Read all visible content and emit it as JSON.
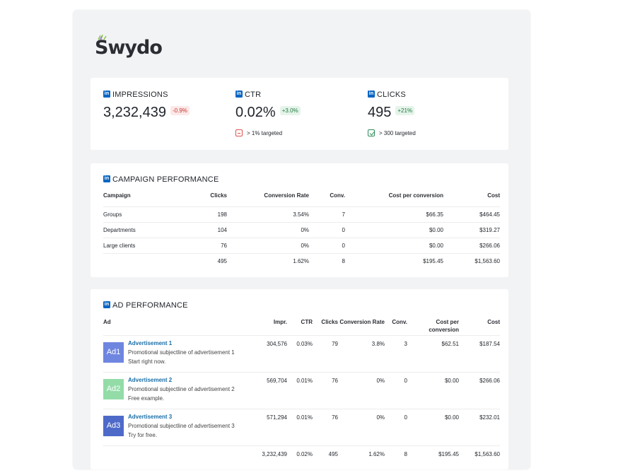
{
  "logo": {
    "text": "Swydo"
  },
  "kpis": [
    {
      "label": "IMPRESSIONS",
      "value": "3,232,439",
      "delta": "-0.9%",
      "delta_type": "negative"
    },
    {
      "label": "CTR",
      "value": "0.02%",
      "delta": "+3.0%",
      "delta_type": "positive",
      "target": "> 1% targeted",
      "target_status": "fail"
    },
    {
      "label": "CLICKS",
      "value": "495",
      "delta": "+21%",
      "delta_type": "positive",
      "target": "> 300 targeted",
      "target_status": "ok"
    }
  ],
  "campaign": {
    "title": "CAMPAIGN PERFORMANCE",
    "headers": [
      "Campaign",
      "Clicks",
      "Conversion Rate",
      "Conv.",
      "Cost per conversion",
      "Cost"
    ],
    "rows": [
      [
        "Groups",
        "198",
        "3.54%",
        "7",
        "$66.35",
        "$464.45"
      ],
      [
        "Departments",
        "104",
        "0%",
        "0",
        "$0.00",
        "$319.27"
      ],
      [
        "Large clients",
        "76",
        "0%",
        "0",
        "$0.00",
        "$266.06"
      ]
    ],
    "total": [
      "",
      "495",
      "1.62%",
      "8",
      "$195.45",
      "$1,563.60"
    ]
  },
  "ads": {
    "title": "AD PERFORMANCE",
    "headers": [
      "Ad",
      "Impr.",
      "CTR",
      "Clicks",
      "Conversion Rate",
      "Conv.",
      "Cost per conversion",
      "Cost"
    ],
    "rows": [
      {
        "thumb": "Ad1",
        "thumb_color": "#6f86e0",
        "title": "Advertisement 1",
        "line1": "Promotional subjectline of advertisement 1",
        "line2": "Start right now.",
        "impr": "304,576",
        "ctr": "0.03%",
        "clicks": "79",
        "conv_rate": "3.8%",
        "conv": "3",
        "cpc": "$62.51",
        "cost": "$187.54"
      },
      {
        "thumb": "Ad2",
        "thumb_color": "#93dca8",
        "title": "Advertisement 2",
        "line1": "Promotional subjectline of advertisement 2",
        "line2": "Free example.",
        "impr": "569,704",
        "ctr": "0.01%",
        "clicks": "76",
        "conv_rate": "0%",
        "conv": "0",
        "cpc": "$0.00",
        "cost": "$266.06"
      },
      {
        "thumb": "Ad3",
        "thumb_color": "#4e6ac9",
        "title": "Advertisement 3",
        "line1": "Promotional subjectline of advertisement 3",
        "line2": "Try for free.",
        "impr": "571,294",
        "ctr": "0.01%",
        "clicks": "76",
        "conv_rate": "0%",
        "conv": "0",
        "cpc": "$0.00",
        "cost": "$232.01"
      }
    ],
    "total": {
      "impr": "3,232,439",
      "ctr": "0.02%",
      "clicks": "495",
      "conv_rate": "1.62%",
      "conv": "8",
      "cpc": "$195.45",
      "cost": "$1,563.60"
    }
  },
  "colors": {
    "linkedin": "#0a66c2",
    "negative": "#c0392b",
    "positive": "#1f7a3e",
    "link": "#1a6fa8"
  }
}
